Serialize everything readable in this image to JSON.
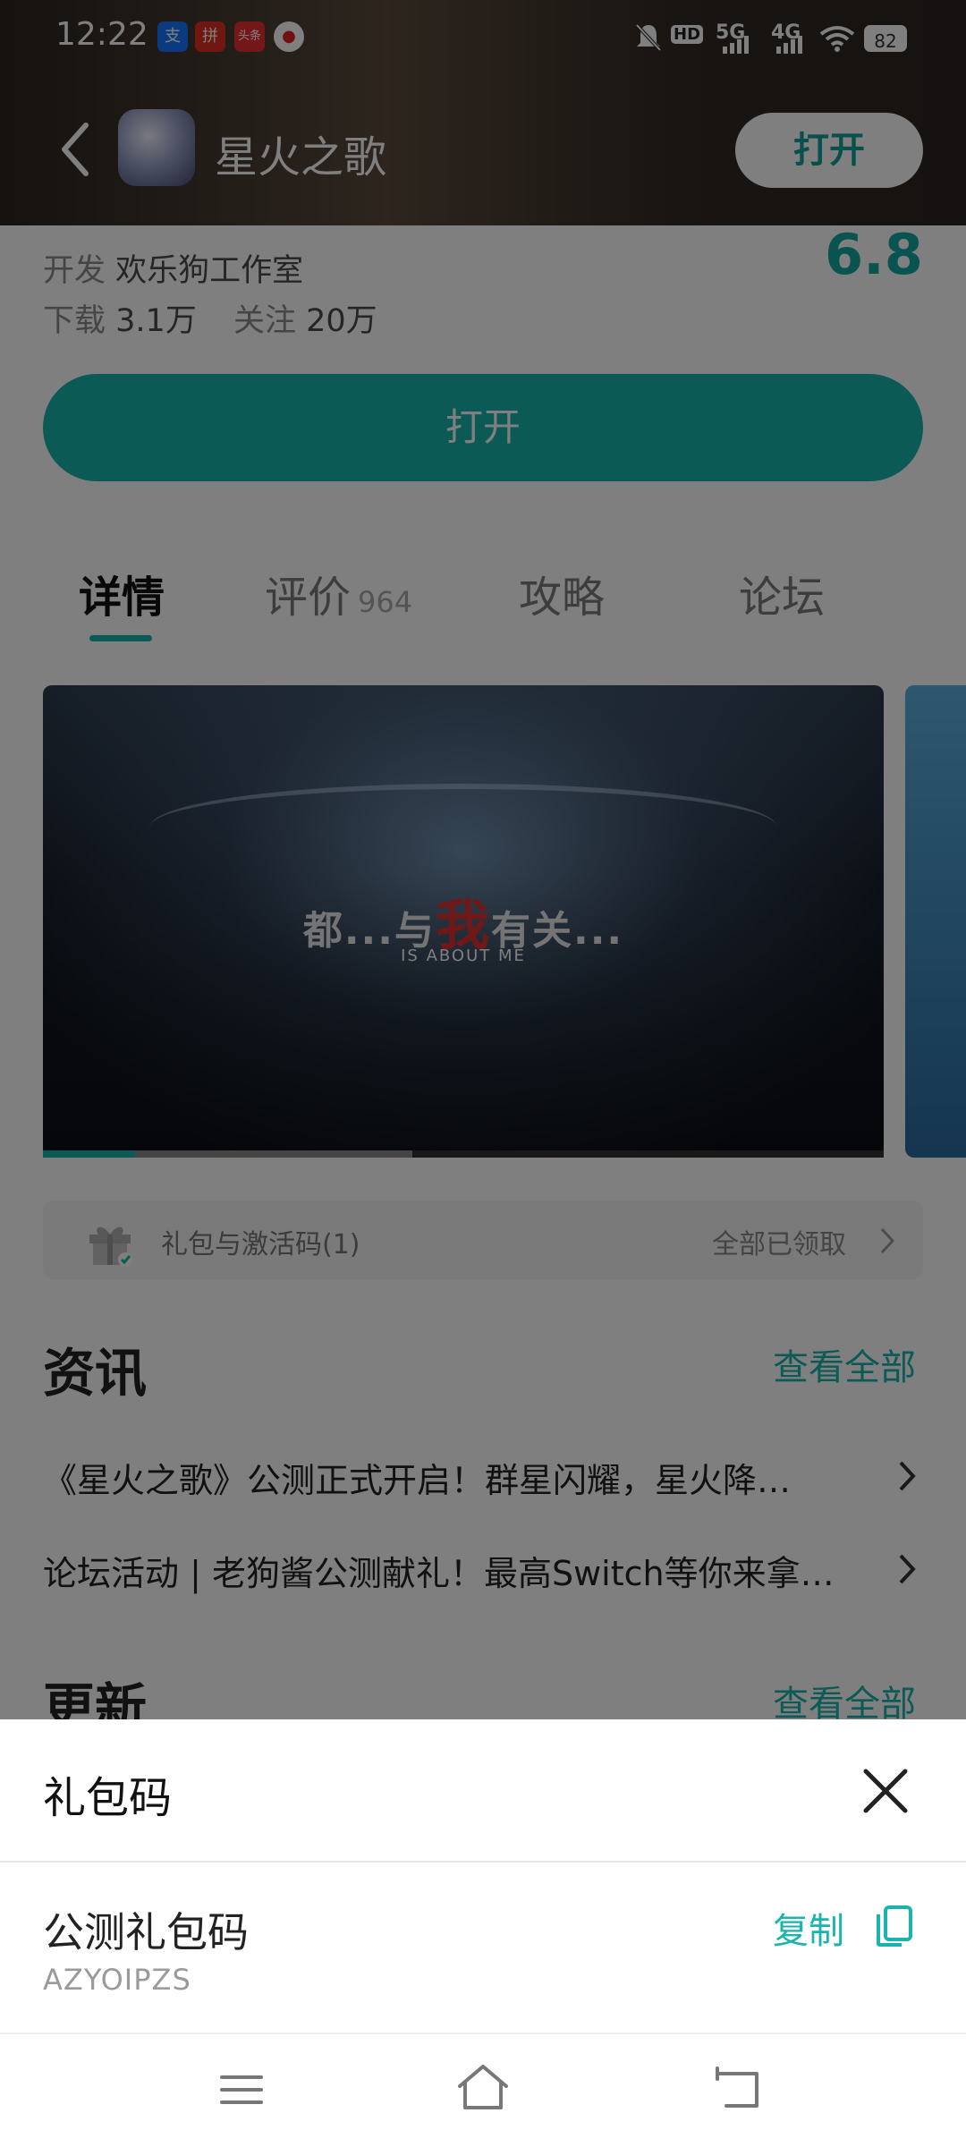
{
  "status_bar": {
    "time": "12:22",
    "apps": [
      {
        "name": "alipay",
        "glyph": "支",
        "color": "#1677ff"
      },
      {
        "name": "pinduoduo",
        "glyph": "拼",
        "color": "#e02e24"
      },
      {
        "name": "toutiao",
        "glyph": "头条",
        "color": "#e8312f"
      },
      {
        "name": "record",
        "glyph": "●",
        "color": "#e02020"
      }
    ],
    "network_1": "HD",
    "network_2": "5G",
    "network_3": "4G",
    "battery": "82"
  },
  "header": {
    "title": "星火之歌",
    "open_label": "打开"
  },
  "app_info": {
    "rating": "6.8",
    "developer_label": "开发",
    "developer": "欢乐狗工作室",
    "downloads_label": "下载",
    "downloads": "3.1万",
    "follows_label": "关注",
    "follows": "20万",
    "open_button": "打开"
  },
  "tabs": [
    {
      "label": "详情"
    },
    {
      "label": "评价",
      "count": "964"
    },
    {
      "label": "攻略"
    },
    {
      "label": "论坛"
    }
  ],
  "video": {
    "caption_pre": "都...与",
    "caption_highlight": "我",
    "caption_post": "有关...",
    "caption_sub": "IS ABOUT ME",
    "progress": 0.11,
    "buffered": 0.44
  },
  "gift": {
    "label": "礼包与激活码(1)",
    "status": "全部已领取"
  },
  "news": {
    "title": "资讯",
    "see_all": "查看全部",
    "items": [
      "《星火之歌》公测正式开启！群星闪耀，星火降…",
      "论坛活动 | 老狗酱公测献礼！最高Switch等你来拿…"
    ]
  },
  "updates": {
    "title": "更新",
    "see_all": "查看全部"
  },
  "sheet": {
    "title": "礼包码",
    "code_name": "公测礼包码",
    "code_value": "AZYOIPZS",
    "copy_label": "复制"
  },
  "colors": {
    "accent": "#19b5ad"
  }
}
